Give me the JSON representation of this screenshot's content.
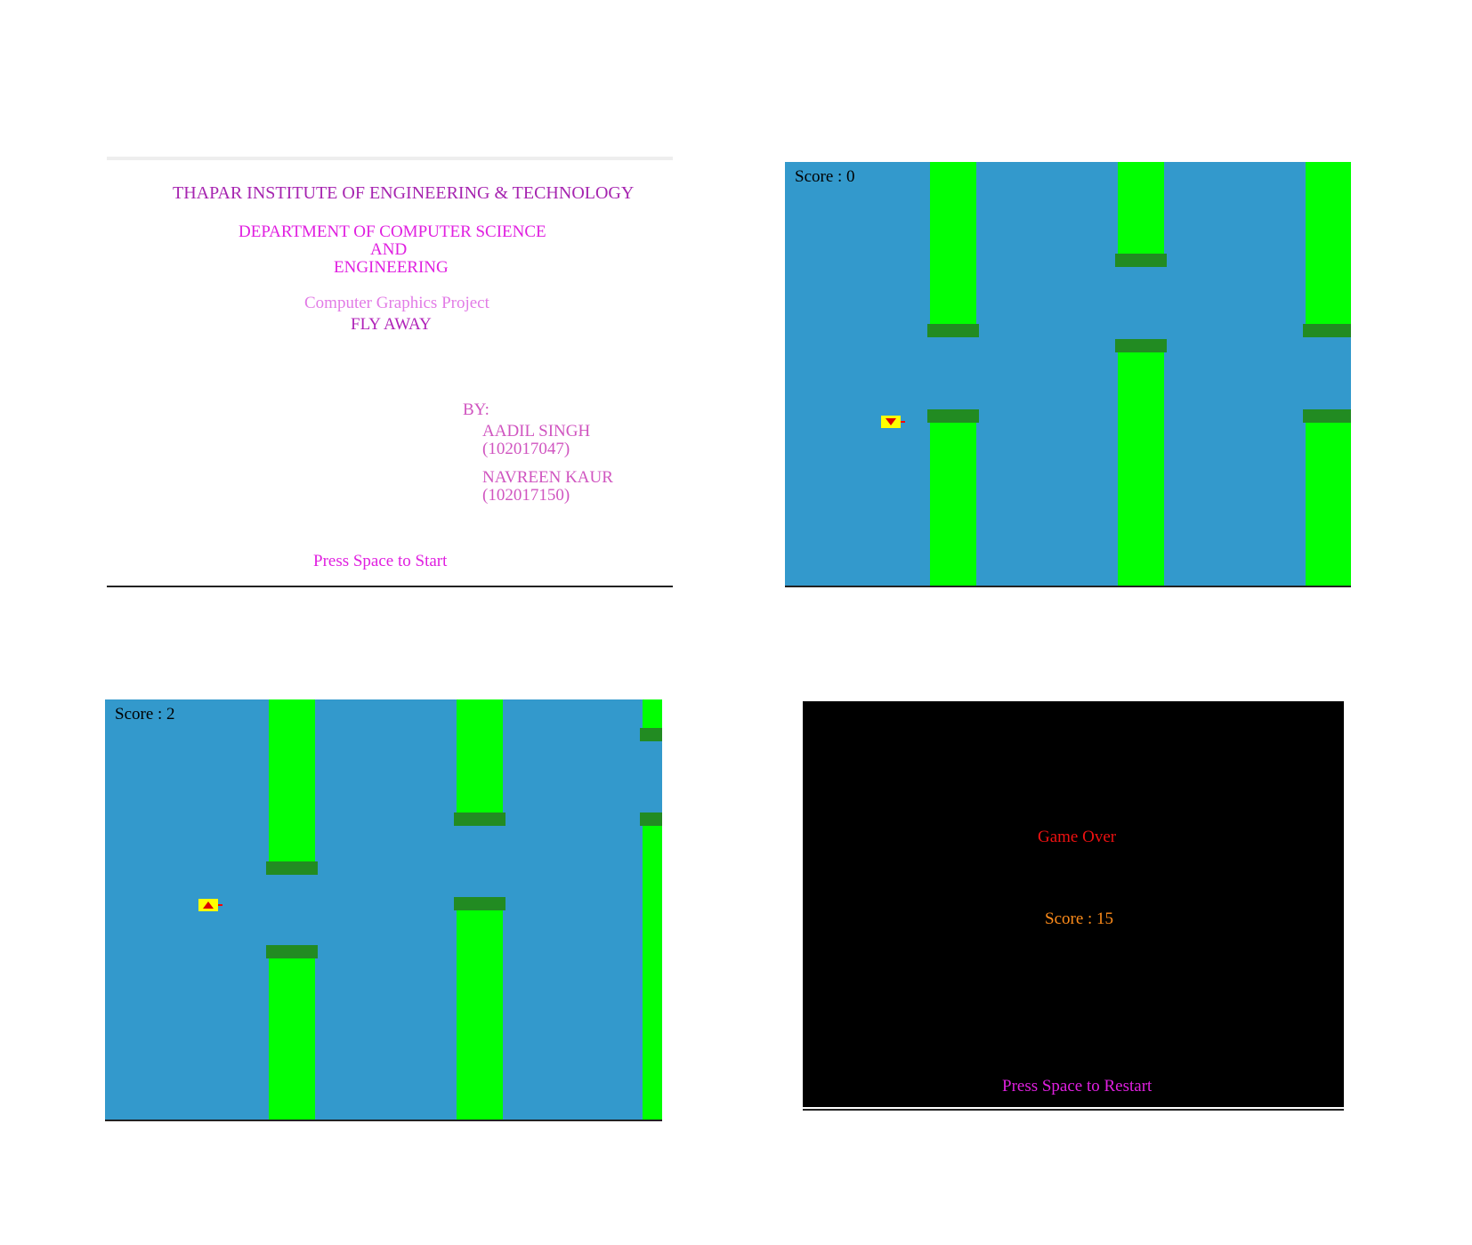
{
  "title_screen": {
    "institute": "THAPAR INSTITUTE OF ENGINEERING & TECHNOLOGY",
    "dept_line1": "DEPARTMENT OF COMPUTER SCIENCE",
    "dept_line2": "AND",
    "dept_line3": "ENGINEERING",
    "project_type": "Computer Graphics Project",
    "project_name": "FLY AWAY",
    "by_label": "BY:",
    "author1_name": "AADIL SINGH",
    "author1_id": "(102017047)",
    "author2_name": "NAVREEN KAUR",
    "author2_id": "(102017150)",
    "prompt": "Press Space to Start"
  },
  "game_screen_1": {
    "score_text": "Score : 0",
    "bird_direction": "down"
  },
  "game_screen_2": {
    "score_text": "Score : 2",
    "bird_direction": "up"
  },
  "game_over_screen": {
    "title": "Game Over",
    "score_text": "Score : 15",
    "prompt": "Press Space to Restart"
  },
  "colors": {
    "sky": "#3399cc",
    "pipe": "#00ff00",
    "pipe_cap": "#228b22",
    "bird": "#ffff00",
    "game_over": "#ee1111",
    "final_score": "#ff8c1a",
    "prompt": "#e020e0"
  }
}
